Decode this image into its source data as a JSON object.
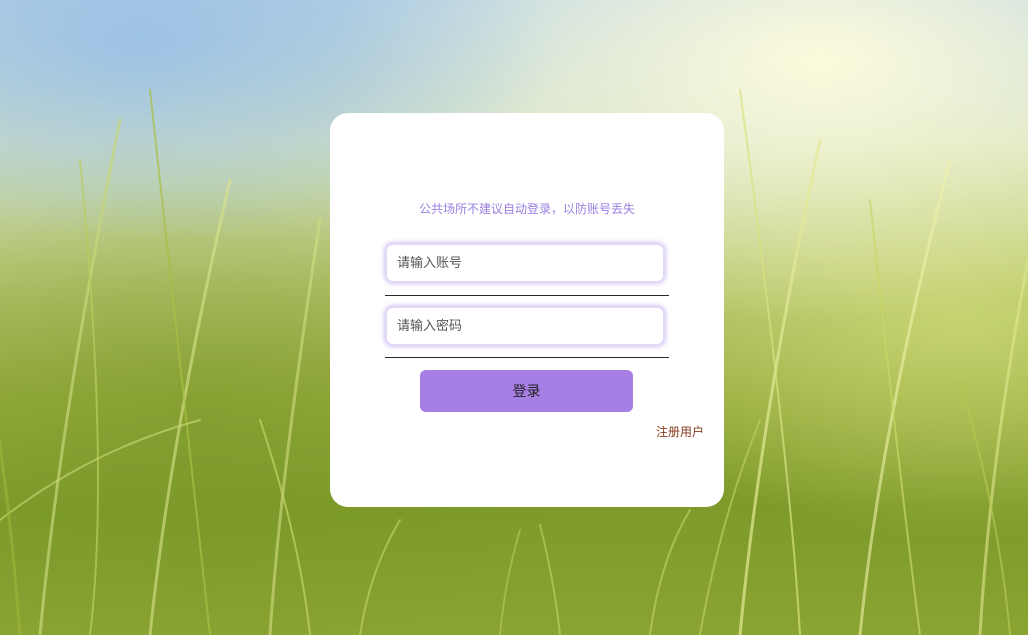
{
  "login": {
    "tip": "公共场所不建议自动登录，以防账号丢失",
    "username_placeholder": "请输入账号",
    "password_placeholder": "请输入密码",
    "login_label": "登录",
    "register_label": "注册用户"
  },
  "colors": {
    "accent": "#a77ee3",
    "tip_text": "#9a7fe0",
    "register_link": "#8a3a1d"
  }
}
